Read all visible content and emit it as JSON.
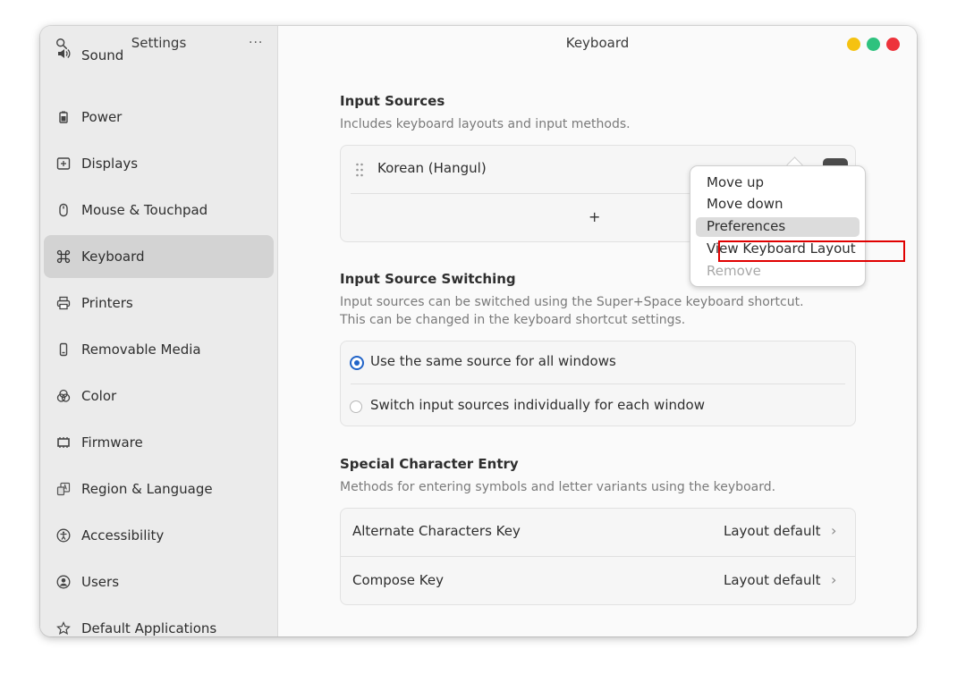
{
  "sidebar": {
    "title": "Settings",
    "menu_label": "···",
    "items": [
      {
        "label": "Sound",
        "icon": "speaker-icon"
      },
      {
        "label": "Power",
        "icon": "battery-icon"
      },
      {
        "label": "Displays",
        "icon": "display-icon"
      },
      {
        "label": "Mouse & Touchpad",
        "icon": "mouse-icon"
      },
      {
        "label": "Keyboard",
        "icon": "command-key-icon"
      },
      {
        "label": "Printers",
        "icon": "printer-icon"
      },
      {
        "label": "Removable Media",
        "icon": "usb-icon"
      },
      {
        "label": "Color",
        "icon": "color-circles-icon"
      },
      {
        "label": "Firmware",
        "icon": "chip-icon"
      },
      {
        "label": "Region & Language",
        "icon": "language-icon"
      },
      {
        "label": "Accessibility",
        "icon": "accessibility-icon"
      },
      {
        "label": "Users",
        "icon": "user-icon"
      },
      {
        "label": "Default Applications",
        "icon": "star-icon"
      }
    ],
    "selected": "Keyboard"
  },
  "main": {
    "title": "Keyboard",
    "input_sources": {
      "title": "Input Sources",
      "subtitle": "Includes keyboard layouts and input methods.",
      "source": "Korean (Hangul)",
      "more_label": "···",
      "add_label": "+"
    },
    "switching": {
      "title": "Input Source Switching",
      "subtitle_line1": "Input sources can be switched using the Super+Space keyboard shortcut.",
      "subtitle_line2": "This can be changed in the keyboard shortcut settings.",
      "option_same": "Use the same source for all windows",
      "option_individual": "Switch input sources individually for each window",
      "selected": "same"
    },
    "special": {
      "title": "Special Character Entry",
      "subtitle": "Methods for entering symbols and letter variants using the keyboard.",
      "rows": [
        {
          "label": "Alternate Characters Key",
          "value": "Layout default"
        },
        {
          "label": "Compose Key",
          "value": "Layout default"
        }
      ],
      "chevron": "›"
    }
  },
  "popover": {
    "items": [
      {
        "label": "Move up",
        "enabled": true
      },
      {
        "label": "Move down",
        "enabled": true
      },
      {
        "label": "Preferences",
        "enabled": true,
        "highlighted": true
      },
      {
        "label": "View Keyboard Layout",
        "enabled": true
      },
      {
        "label": "Remove",
        "enabled": false
      }
    ]
  },
  "colors": {
    "accent": "#2164c8",
    "highlight_box": "#e00000",
    "minimize": "#f5c211",
    "maximize": "#2ec27e",
    "close": "#ed333b"
  }
}
